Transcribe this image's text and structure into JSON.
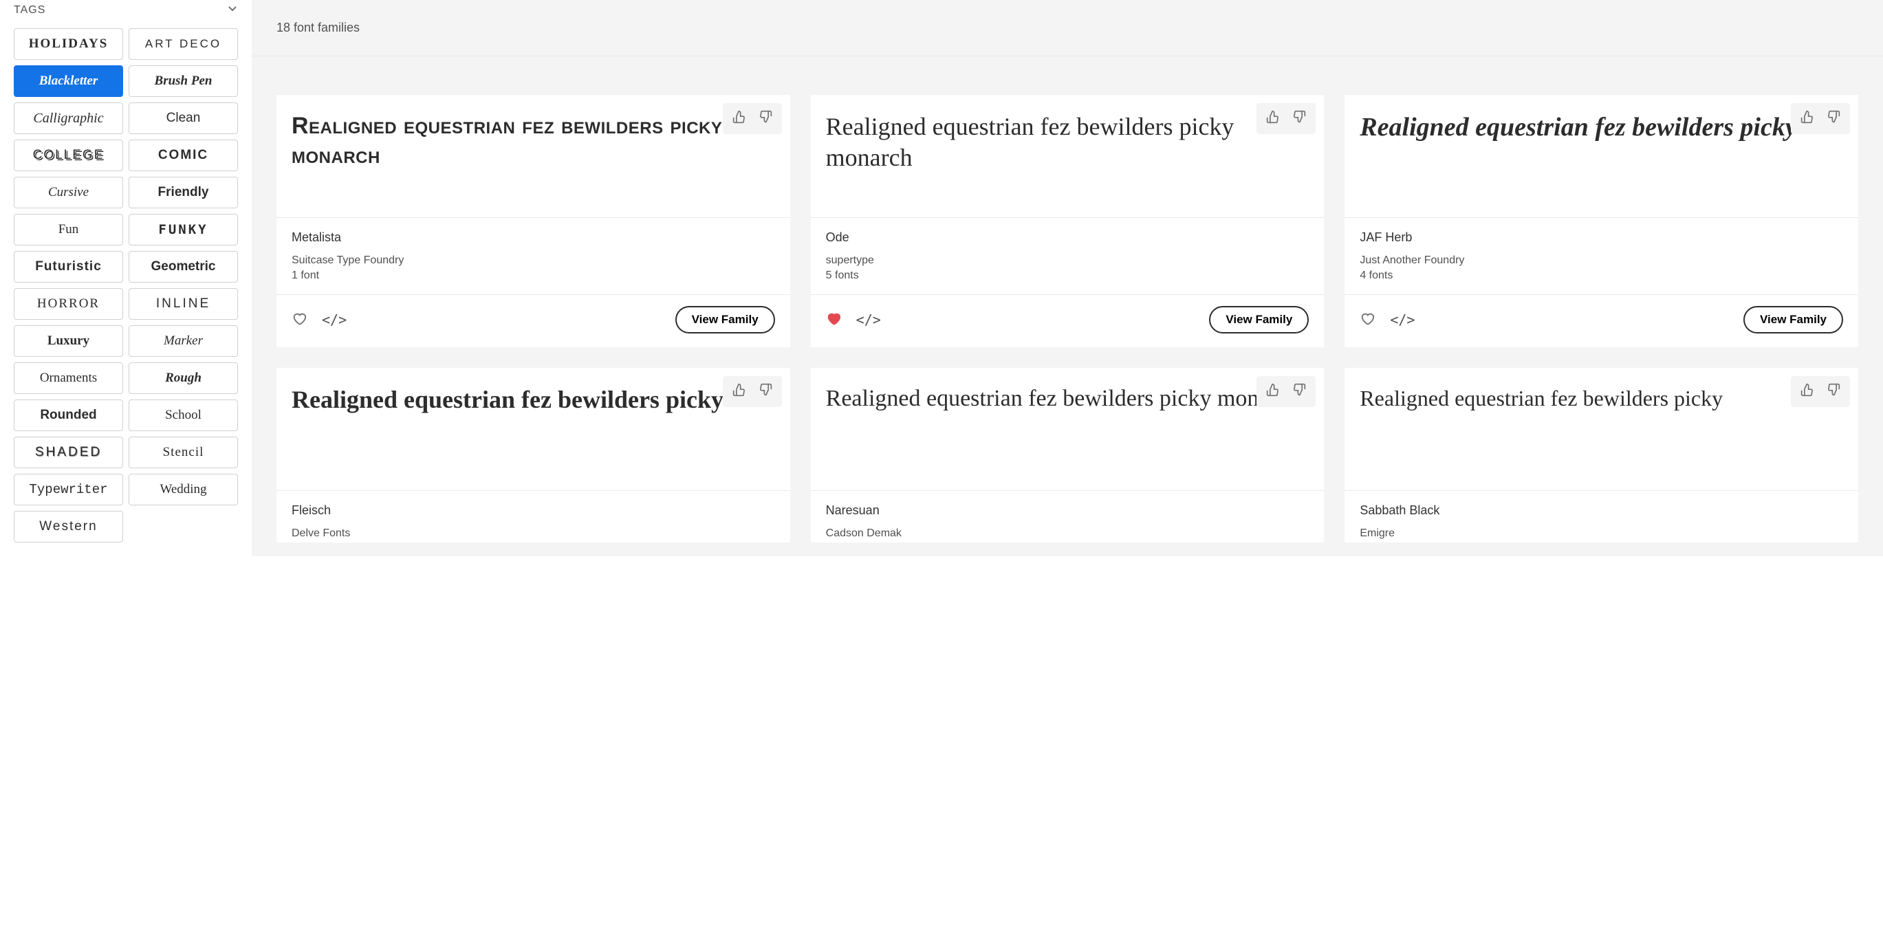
{
  "sidebar": {
    "title": "TAGS",
    "tags": [
      {
        "label": "HOLIDAYS",
        "style": "t-holidays",
        "selected": false
      },
      {
        "label": "ART DECO",
        "style": "t-artdeco",
        "selected": false
      },
      {
        "label": "Blackletter",
        "style": "t-blackletter",
        "selected": true
      },
      {
        "label": "Brush Pen",
        "style": "t-brushpen",
        "selected": false
      },
      {
        "label": "Calligraphic",
        "style": "t-calligraphic",
        "selected": false
      },
      {
        "label": "Clean",
        "style": "t-clean",
        "selected": false
      },
      {
        "label": "COLLEGE",
        "style": "t-college",
        "selected": false
      },
      {
        "label": "COMIC",
        "style": "t-comic",
        "selected": false
      },
      {
        "label": "Cursive",
        "style": "t-cursive",
        "selected": false
      },
      {
        "label": "Friendly",
        "style": "t-friendly",
        "selected": false
      },
      {
        "label": "Fun",
        "style": "t-fun",
        "selected": false
      },
      {
        "label": "FUNKY",
        "style": "t-funky",
        "selected": false
      },
      {
        "label": "Futuristic",
        "style": "t-futuristic",
        "selected": false
      },
      {
        "label": "Geometric",
        "style": "t-geometric",
        "selected": false
      },
      {
        "label": "HORROR",
        "style": "t-horror",
        "selected": false
      },
      {
        "label": "INLINE",
        "style": "t-inline",
        "selected": false
      },
      {
        "label": "Luxury",
        "style": "t-luxury",
        "selected": false
      },
      {
        "label": "Marker",
        "style": "t-marker",
        "selected": false
      },
      {
        "label": "Ornaments",
        "style": "t-ornaments",
        "selected": false
      },
      {
        "label": "Rough",
        "style": "t-rough",
        "selected": false
      },
      {
        "label": "Rounded",
        "style": "t-rounded",
        "selected": false
      },
      {
        "label": "School",
        "style": "t-school",
        "selected": false
      },
      {
        "label": "SHADED",
        "style": "t-shaded",
        "selected": false
      },
      {
        "label": "Stencil",
        "style": "t-stencil",
        "selected": false
      },
      {
        "label": "Typewriter",
        "style": "t-typewriter",
        "selected": false
      },
      {
        "label": "Wedding",
        "style": "t-wedding",
        "selected": false
      },
      {
        "label": "Western",
        "style": "t-western",
        "selected": false
      }
    ]
  },
  "results": {
    "count_label": "18 font families",
    "sample_text": "Realigned equestrian fez bewilders picky monarch",
    "view_family_label": "View Family",
    "cards": [
      {
        "name": "Metalista",
        "foundry": "Suitcase Type Foundry",
        "count": "1 font",
        "favorited": false,
        "preview_class": "pv-metalista",
        "preview_text": "Realigned equestrian fez bewilders picky monarch"
      },
      {
        "name": "Ode",
        "foundry": "supertype",
        "count": "5 fonts",
        "favorited": true,
        "preview_class": "pv-ode",
        "preview_text": "Realigned equestrian fez bewilders picky monarch"
      },
      {
        "name": "JAF Herb",
        "foundry": "Just Another Foundry",
        "count": "4 fonts",
        "favorited": false,
        "preview_class": "pv-jafherb",
        "preview_text": "Realigned equestrian fez bewilders picky"
      },
      {
        "name": "Fleisch",
        "foundry": "Delve Fonts",
        "count": "",
        "favorited": false,
        "preview_class": "pv-fleisch",
        "preview_text": "Realigned equestrian fez bewilders picky",
        "partial": true
      },
      {
        "name": "Naresuan",
        "foundry": "Cadson Demak",
        "count": "",
        "favorited": false,
        "preview_class": "pv-naresuan",
        "preview_text": "Realigned equestrian fez bewilders picky monarch",
        "partial": true
      },
      {
        "name": "Sabbath Black",
        "foundry": "Emigre",
        "count": "",
        "favorited": false,
        "preview_class": "pv-sabbath",
        "preview_text": "Realigned equestrian fez bewilders picky",
        "partial": true
      }
    ]
  }
}
